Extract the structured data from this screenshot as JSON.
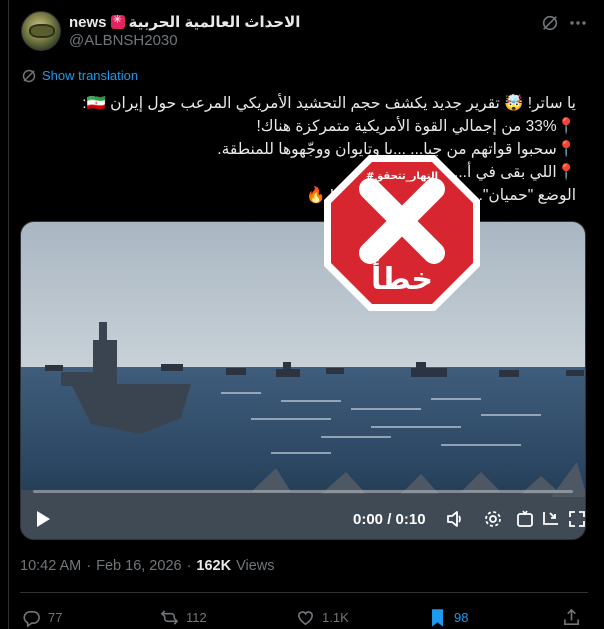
{
  "author": {
    "name_text": "الاحداث العالمية الحربية",
    "name_suffix": "news",
    "handle": "@ALBNSH2030"
  },
  "translate_label": "Show translation",
  "tweet_lines": [
    "يا ساتر! 🤯 تقرير جديد يكشف حجم التحشيد الأمريكي المرعب حول إيران 🇮🇷:",
    "33% من إجمالي القوة الأمريكية متمركزة هناك!",
    "سحبوا قواتهم من جبا... ...با وتايوان ووجّهوها للمنطقة.",
    "اللي بقى في أ... ...ن قواتهم.",
    "الوضع \"حميان\"... ...عية أبدًا.. الله يستر! 🔥"
  ],
  "video": {
    "time_label": "0:00 / 0:10",
    "progress": 0
  },
  "stamp": {
    "label": "خطأ",
    "brand": "#النهار_تتحقق",
    "color": "#d7262f"
  },
  "meta": {
    "time": "10:42 AM",
    "date": "Feb 16, 2026",
    "views_count": "162K",
    "views_label": "Views"
  },
  "actions": {
    "replies": "77",
    "reposts": "112",
    "likes": "1.1K",
    "bookmarks": "98"
  },
  "colors": {
    "accent": "#1d9bf0",
    "muted": "#71767b",
    "text": "#e7e9ea"
  }
}
